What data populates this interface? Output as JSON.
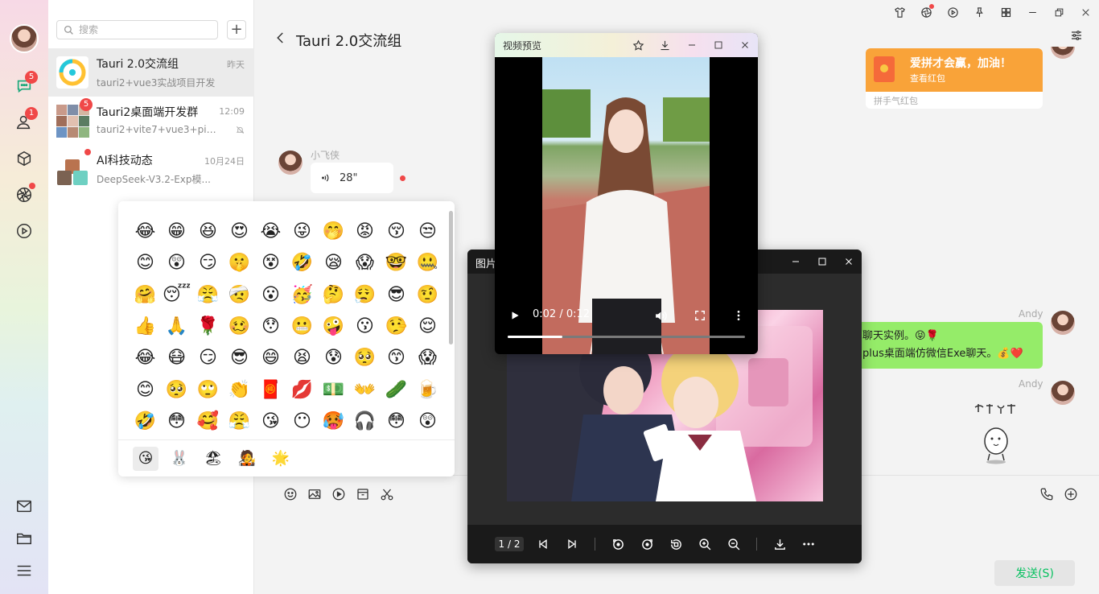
{
  "colors": {
    "accent_green": "#07c160",
    "bubble_green": "#95ec69",
    "badge_red": "#f04848",
    "redpacket_orange": "#f9a339"
  },
  "rail": {
    "icons": [
      "chat-bubble-icon",
      "contacts-icon",
      "cube-icon",
      "aperture-icon",
      "play-circle-icon",
      "mail-icon",
      "folder-icon",
      "menu-icon"
    ],
    "chat_badge": "5",
    "contacts_badge": "1"
  },
  "list": {
    "search_placeholder": "搜索",
    "add_label": "+",
    "conversations": [
      {
        "name": "Tauri 2.0交流组",
        "time": "昨天",
        "preview": "tauri2+vue3实战项目开发",
        "badge": ""
      },
      {
        "name": "Tauri2桌面端开发群",
        "time": "12:09",
        "preview": "tauri2+vite7+vue3+pinia3...",
        "badge": "5"
      },
      {
        "name": "AI科技动态",
        "time": "10月24日",
        "preview": "DeepSeek-V3.2-Exp模...",
        "badge": ""
      }
    ]
  },
  "chat": {
    "title": "Tauri 2.0交流组",
    "redpacket": {
      "title": "爱拼才会赢，加油！",
      "subtitle": "查看红包",
      "footer": "拼手气红包"
    },
    "voice": {
      "sender": "小飞侠",
      "duration": "28\""
    },
    "sender_right": "Andy",
    "green_line1": "聊天实例。😝🌹",
    "green_line2": "plus桌面端仿微信Exe聊天。💰❤️",
    "sender_right_2": "Andy",
    "send_label": "发送(S)"
  },
  "emoji_panel": {
    "emojis": [
      "😂",
      "😁",
      "😆",
      "😍",
      "😭",
      "😜",
      "🤭",
      "😡",
      "😚",
      "😒",
      "😊",
      "😲",
      "😏",
      "🤫",
      "😵",
      "🤣",
      "😪",
      "😱",
      "🤓",
      "🤐",
      "🤗",
      "😴",
      "😤",
      "🤕",
      "😮",
      "🥳",
      "🤔",
      "😮‍💨",
      "😎",
      "🤨",
      "👍",
      "🙏",
      "🌹",
      "🥴",
      "😯",
      "😬",
      "🤪",
      "😗",
      "🤥",
      "😌",
      "😂",
      "😷",
      "😏",
      "😎",
      "😄",
      "😫",
      "😰",
      "🥺",
      "😙",
      "😱",
      "😊",
      "🥺",
      "🙄",
      "👏",
      "🧧",
      "💋",
      "💵",
      "👐",
      "🥒",
      "🍺",
      "🤣",
      "😳",
      "🥰",
      "😤",
      "😘",
      "😶",
      "🥵",
      "🎧",
      "😳",
      "😲"
    ],
    "tabs": [
      "😘",
      "🐰",
      "🏖",
      "🧑‍🎤",
      "🌟"
    ]
  },
  "image_viewer": {
    "title": "图片",
    "page": "1 / 2"
  },
  "video_preview": {
    "title": "视频预览",
    "time": "0:02 / 0:12",
    "progress": 0.23
  }
}
